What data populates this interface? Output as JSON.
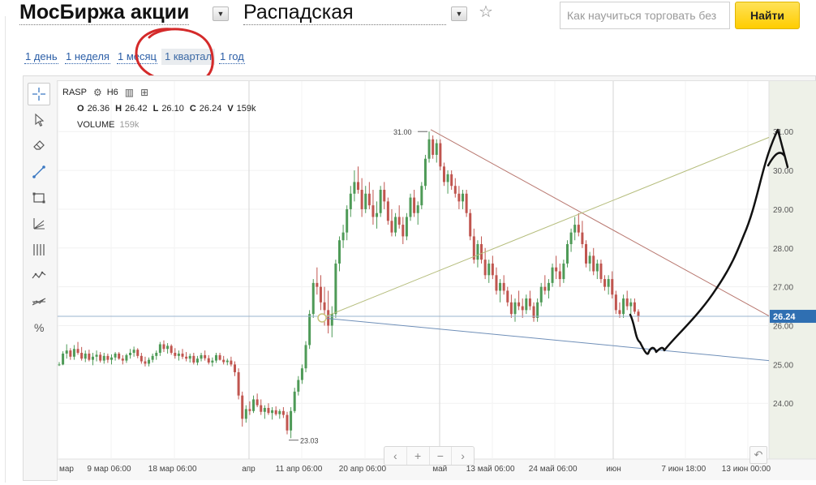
{
  "header": {
    "title": "МосБиржа акции",
    "instrument": "Распадская",
    "search_placeholder": "Как научиться торговать без",
    "search_button": "Найти"
  },
  "periods": [
    {
      "label": "1 день",
      "active": false
    },
    {
      "label": "1 неделя",
      "active": false
    },
    {
      "label": "1 месяц",
      "active": false
    },
    {
      "label": "1 квартал",
      "active": true
    },
    {
      "label": "1 год",
      "active": false
    }
  ],
  "legend": {
    "ticker": "RASP",
    "timeframe": "H6",
    "ohlc": [
      {
        "key": "O",
        "value": "26.36"
      },
      {
        "key": "H",
        "value": "26.42"
      },
      {
        "key": "L",
        "value": "26.10"
      },
      {
        "key": "C",
        "value": "26.24"
      },
      {
        "key": "V",
        "value": "159k"
      }
    ],
    "volume_label": "VOLUME",
    "volume_value": "159k"
  },
  "nav": {
    "prev": "‹",
    "zoom_in": "+",
    "zoom_out": "−",
    "next": "›",
    "reset": "↶"
  },
  "tools": [
    "crosshair-tool",
    "pointer-tool",
    "eraser-tool",
    "trendline-tool",
    "rectangle-tool",
    "fib-fan-tool",
    "vertical-lines-tool",
    "wave-tool",
    "channel-tool",
    "percent-tool"
  ],
  "chart_data": {
    "type": "candlestick",
    "y_ticks": [
      "31.00",
      "30.00",
      "29.00",
      "28.00",
      "27.00",
      "26.00",
      "25.00",
      "24.00"
    ],
    "ylim": [
      22.02,
      32.3
    ],
    "x_ticks": [
      "мар",
      "9 мар 06:00",
      "18 мар 06:00",
      "апр",
      "11 апр 06:00",
      "20 апр 06:00",
      "май",
      "13 май 06:00",
      "24 май 06:00",
      "июн",
      "7 июн 18:00",
      "13 июн 00:00"
    ],
    "last_price": 26.24,
    "annotations": [
      {
        "label": "31.00",
        "kind": "high-marker"
      },
      {
        "label": "23.03",
        "kind": "low-marker"
      }
    ],
    "colors": {
      "up": "#4e9a57",
      "down": "#c0554f",
      "resistance": "#b8776f",
      "support_up": "#b5bd7c",
      "support_down": "#6f8fb8",
      "price_line": "#9ab4cf",
      "price_label": "#2f6fb2"
    },
    "candles": [
      [
        25.0,
        25.06,
        24.96,
        25.0
      ],
      [
        25.0,
        25.34,
        24.98,
        25.28
      ],
      [
        25.28,
        25.52,
        25.15,
        25.36
      ],
      [
        25.36,
        25.42,
        25.12,
        25.2
      ],
      [
        25.2,
        25.5,
        25.12,
        25.4
      ],
      [
        25.4,
        25.58,
        25.25,
        25.3
      ],
      [
        25.3,
        25.45,
        25.1,
        25.15
      ],
      [
        25.15,
        25.36,
        25.06,
        25.28
      ],
      [
        25.28,
        25.38,
        25.08,
        25.12
      ],
      [
        25.12,
        25.3,
        24.98,
        25.2
      ],
      [
        25.2,
        25.36,
        25.08,
        25.25
      ],
      [
        25.25,
        25.32,
        25.05,
        25.1
      ],
      [
        25.1,
        25.3,
        25.02,
        25.22
      ],
      [
        25.22,
        25.28,
        25.04,
        25.12
      ],
      [
        25.12,
        25.26,
        25.0,
        25.18
      ],
      [
        25.18,
        25.32,
        25.1,
        25.28
      ],
      [
        25.28,
        25.32,
        25.12,
        25.15
      ],
      [
        25.15,
        25.24,
        25.0,
        25.1
      ],
      [
        25.1,
        25.28,
        25.04,
        25.24
      ],
      [
        25.24,
        25.4,
        25.15,
        25.3
      ],
      [
        25.3,
        25.46,
        25.2,
        25.38
      ],
      [
        25.38,
        25.42,
        25.16,
        25.22
      ],
      [
        25.22,
        25.3,
        25.02,
        25.08
      ],
      [
        25.08,
        25.2,
        24.95,
        25.02
      ],
      [
        25.02,
        25.18,
        24.95,
        25.12
      ],
      [
        25.12,
        25.28,
        25.05,
        25.22
      ],
      [
        25.22,
        25.36,
        25.12,
        25.3
      ],
      [
        25.3,
        25.58,
        25.22,
        25.52
      ],
      [
        25.52,
        25.62,
        25.32,
        25.4
      ],
      [
        25.4,
        25.55,
        25.28,
        25.48
      ],
      [
        25.48,
        25.52,
        25.25,
        25.3
      ],
      [
        25.3,
        25.42,
        25.15,
        25.22
      ],
      [
        25.22,
        25.36,
        25.1,
        25.28
      ],
      [
        25.28,
        25.4,
        25.14,
        25.2
      ],
      [
        25.2,
        25.32,
        25.08,
        25.15
      ],
      [
        25.15,
        25.28,
        25.05,
        25.22
      ],
      [
        25.22,
        25.3,
        25.0,
        25.05
      ],
      [
        25.05,
        25.22,
        24.98,
        25.15
      ],
      [
        25.15,
        25.3,
        25.08,
        25.24
      ],
      [
        25.24,
        25.36,
        25.1,
        25.16
      ],
      [
        25.16,
        25.24,
        25.0,
        25.05
      ],
      [
        25.05,
        25.18,
        24.95,
        25.1
      ],
      [
        25.1,
        25.3,
        25.04,
        25.24
      ],
      [
        25.24,
        25.3,
        25.1,
        25.12
      ],
      [
        25.12,
        25.22,
        25.0,
        25.06
      ],
      [
        25.06,
        25.15,
        24.98,
        25.1
      ],
      [
        25.1,
        25.2,
        24.95,
        25.0
      ],
      [
        25.0,
        25.08,
        24.7,
        24.8
      ],
      [
        24.8,
        24.9,
        24.1,
        24.2
      ],
      [
        24.2,
        24.3,
        23.4,
        23.6
      ],
      [
        23.6,
        23.95,
        23.5,
        23.85
      ],
      [
        23.85,
        24.05,
        23.7,
        23.8
      ],
      [
        23.8,
        24.2,
        23.75,
        24.1
      ],
      [
        24.1,
        24.25,
        23.9,
        23.95
      ],
      [
        23.95,
        24.1,
        23.7,
        23.78
      ],
      [
        23.78,
        23.95,
        23.6,
        23.88
      ],
      [
        23.88,
        24.0,
        23.7,
        23.75
      ],
      [
        23.75,
        23.9,
        23.58,
        23.82
      ],
      [
        23.82,
        23.92,
        23.68,
        23.72
      ],
      [
        23.72,
        23.85,
        23.6,
        23.8
      ],
      [
        23.8,
        23.9,
        23.62,
        23.7
      ],
      [
        23.7,
        23.78,
        23.2,
        23.3
      ],
      [
        23.3,
        23.9,
        23.1,
        23.8
      ],
      [
        23.8,
        24.4,
        23.75,
        24.3
      ],
      [
        24.3,
        24.7,
        24.2,
        24.6
      ],
      [
        24.6,
        25.0,
        24.5,
        24.9
      ],
      [
        24.9,
        25.6,
        24.8,
        25.5
      ],
      [
        25.5,
        26.4,
        25.4,
        26.3
      ],
      [
        26.3,
        27.2,
        26.2,
        27.1
      ],
      [
        27.1,
        27.5,
        26.8,
        27.0
      ],
      [
        27.0,
        27.3,
        26.4,
        26.6
      ],
      [
        26.6,
        27.0,
        26.0,
        26.4
      ],
      [
        26.4,
        26.9,
        25.8,
        26.0
      ],
      [
        26.0,
        26.5,
        25.7,
        26.3
      ],
      [
        26.3,
        27.7,
        26.2,
        27.6
      ],
      [
        27.6,
        28.3,
        27.4,
        28.2
      ],
      [
        28.2,
        28.6,
        28.0,
        28.4
      ],
      [
        28.4,
        29.1,
        28.2,
        29.0
      ],
      [
        29.0,
        29.6,
        28.8,
        29.4
      ],
      [
        29.4,
        30.0,
        29.2,
        29.7
      ],
      [
        29.7,
        30.1,
        29.4,
        29.5
      ],
      [
        29.5,
        29.8,
        28.8,
        29.0
      ],
      [
        29.0,
        29.6,
        28.9,
        29.4
      ],
      [
        29.4,
        29.7,
        29.0,
        29.1
      ],
      [
        29.1,
        29.5,
        28.6,
        28.8
      ],
      [
        28.8,
        29.2,
        28.5,
        28.9
      ],
      [
        28.9,
        29.6,
        28.8,
        29.5
      ],
      [
        29.5,
        29.7,
        29.0,
        29.2
      ],
      [
        29.2,
        29.3,
        28.6,
        28.7
      ],
      [
        28.7,
        29.0,
        28.3,
        28.4
      ],
      [
        28.4,
        28.9,
        28.3,
        28.8
      ],
      [
        28.8,
        29.1,
        28.5,
        28.6
      ],
      [
        28.6,
        28.8,
        28.1,
        28.3
      ],
      [
        28.3,
        28.9,
        28.2,
        28.8
      ],
      [
        28.8,
        29.4,
        28.7,
        29.3
      ],
      [
        29.3,
        29.5,
        28.8,
        28.9
      ],
      [
        28.9,
        29.2,
        28.6,
        29.1
      ],
      [
        29.1,
        29.7,
        29.0,
        29.6
      ],
      [
        29.6,
        30.4,
        29.5,
        30.3
      ],
      [
        30.3,
        31.0,
        30.2,
        30.8
      ],
      [
        30.8,
        30.9,
        30.3,
        30.4
      ],
      [
        30.4,
        30.8,
        30.2,
        30.7
      ],
      [
        30.7,
        30.8,
        30.0,
        30.1
      ],
      [
        30.1,
        30.2,
        29.6,
        29.7
      ],
      [
        29.7,
        30.0,
        29.4,
        29.9
      ],
      [
        29.9,
        30.0,
        29.5,
        29.6
      ],
      [
        29.6,
        29.8,
        29.3,
        29.4
      ],
      [
        29.4,
        29.6,
        29.0,
        29.2
      ],
      [
        29.2,
        29.5,
        29.0,
        29.4
      ],
      [
        29.4,
        29.5,
        28.8,
        28.9
      ],
      [
        28.9,
        29.0,
        28.2,
        28.3
      ],
      [
        28.3,
        28.5,
        27.6,
        27.7
      ],
      [
        27.7,
        28.2,
        27.5,
        28.1
      ],
      [
        28.1,
        28.3,
        27.6,
        27.7
      ],
      [
        27.7,
        28.0,
        27.2,
        27.3
      ],
      [
        27.3,
        27.7,
        27.1,
        27.6
      ],
      [
        27.6,
        27.8,
        27.2,
        27.3
      ],
      [
        27.3,
        27.5,
        26.8,
        26.9
      ],
      [
        26.9,
        27.2,
        26.6,
        27.1
      ],
      [
        27.1,
        27.3,
        26.8,
        26.9
      ],
      [
        26.9,
        27.0,
        26.5,
        26.6
      ],
      [
        26.6,
        26.8,
        26.2,
        26.3
      ],
      [
        26.3,
        26.7,
        26.1,
        26.6
      ],
      [
        26.6,
        26.9,
        26.4,
        26.5
      ],
      [
        26.5,
        26.7,
        26.2,
        26.4
      ],
      [
        26.4,
        26.8,
        26.3,
        26.7
      ],
      [
        26.7,
        26.9,
        26.4,
        26.5
      ],
      [
        26.5,
        26.6,
        26.1,
        26.2
      ],
      [
        26.2,
        26.7,
        26.1,
        26.6
      ],
      [
        26.6,
        27.1,
        26.5,
        27.0
      ],
      [
        27.0,
        27.3,
        26.8,
        26.9
      ],
      [
        26.9,
        27.2,
        26.7,
        27.1
      ],
      [
        27.1,
        27.6,
        27.0,
        27.5
      ],
      [
        27.5,
        27.8,
        27.2,
        27.4
      ],
      [
        27.4,
        27.6,
        27.0,
        27.2
      ],
      [
        27.2,
        27.7,
        27.1,
        27.6
      ],
      [
        27.6,
        28.2,
        27.5,
        28.1
      ],
      [
        28.1,
        28.5,
        27.9,
        28.4
      ],
      [
        28.4,
        28.8,
        28.2,
        28.6
      ],
      [
        28.6,
        28.9,
        28.3,
        28.4
      ],
      [
        28.4,
        28.7,
        28.0,
        28.1
      ],
      [
        28.1,
        28.2,
        27.5,
        27.6
      ],
      [
        27.6,
        27.9,
        27.4,
        27.8
      ],
      [
        27.8,
        28.0,
        27.3,
        27.4
      ],
      [
        27.4,
        27.7,
        27.2,
        27.6
      ],
      [
        27.6,
        27.7,
        27.1,
        27.2
      ],
      [
        27.2,
        27.3,
        26.9,
        27.0
      ],
      [
        27.0,
        27.3,
        26.8,
        27.2
      ],
      [
        27.2,
        27.4,
        26.7,
        26.8
      ],
      [
        26.8,
        26.9,
        26.3,
        26.4
      ],
      [
        26.4,
        26.6,
        26.2,
        26.3
      ],
      [
        26.3,
        26.8,
        26.2,
        26.7
      ],
      [
        26.7,
        26.9,
        26.4,
        26.5
      ],
      [
        26.5,
        26.7,
        26.3,
        26.6
      ],
      [
        26.6,
        26.7,
        26.3,
        26.36
      ],
      [
        26.36,
        26.42,
        26.1,
        26.24
      ]
    ]
  }
}
